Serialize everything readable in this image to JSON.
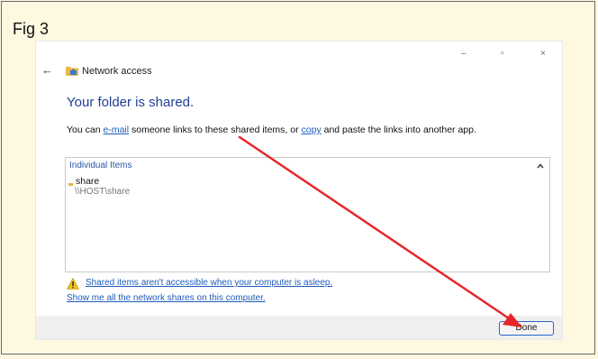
{
  "figure": {
    "label": "Fig 3"
  },
  "window": {
    "controls": {
      "minimize": "–",
      "maximize": "▫",
      "close": "×"
    },
    "back_icon": "back-arrow-icon",
    "title_icon": "network-folder-icon",
    "title": "Network access"
  },
  "main": {
    "heading": "Your folder is shared.",
    "description": {
      "part1": "You can ",
      "email_link": "e-mail",
      "part2": " someone links to these shared items, or ",
      "copy_link": "copy",
      "part3": " and paste the links into another app."
    },
    "items_box": {
      "header": "Individual Items",
      "collapse_icon": "chevron-up-icon",
      "items": [
        {
          "name": "share",
          "path": "\\\\HOST\\share",
          "icon": "folder-icon"
        }
      ]
    },
    "warning_link": "Shared items aren't accessible when your computer is asleep.",
    "warning_icon": "warning-icon",
    "shares_link": "Show me all the network shares on this computer."
  },
  "footer": {
    "done_label": "Done"
  },
  "annotation": {
    "color": "#e8262a",
    "icon": "red-arrow"
  }
}
